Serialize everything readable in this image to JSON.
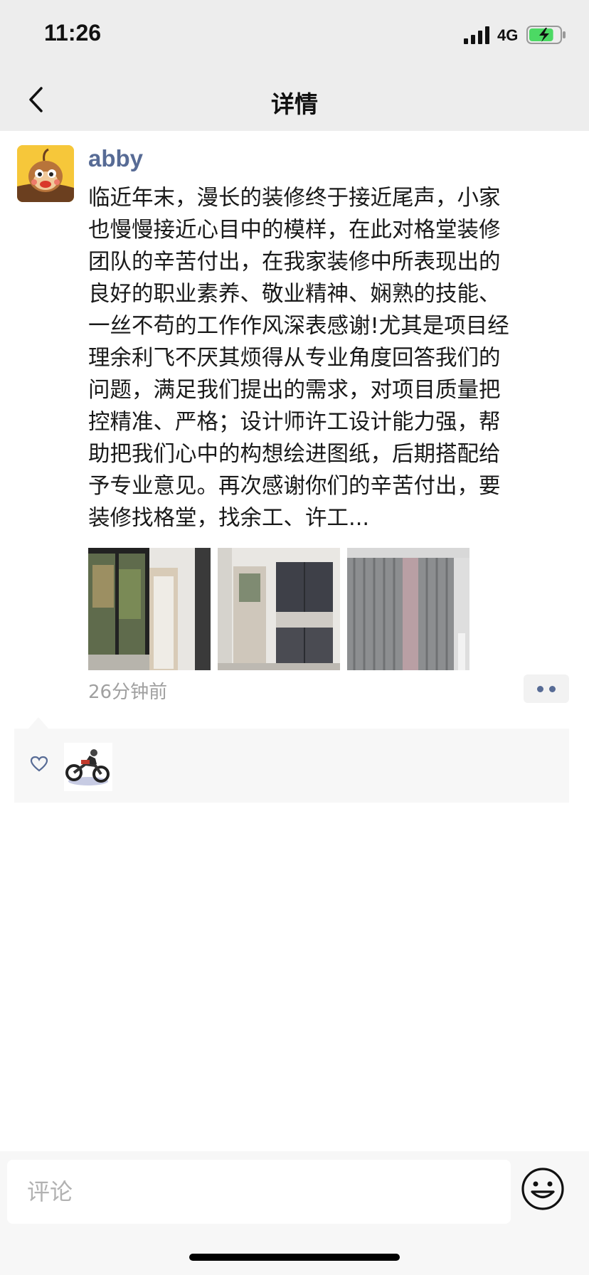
{
  "status_bar": {
    "time": "11:26",
    "network": "4G",
    "battery_fill": 0.8,
    "battery_color": "#4cd964"
  },
  "nav": {
    "title": "详情",
    "back_icon": "chevron-left-icon"
  },
  "post": {
    "author": "abby",
    "author_color": "#576b95",
    "content": "临近年末，漫长的装修终于接近尾声，小家\n也慢慢接近心目中的模样，在此对格堂装修\n团队的辛苦付出，在我家装修中所表现出的\n良好的职业素养、敬业精神、娴熟的技能、\n一丝不苟的工作作风深表感谢!尤其是项目经\n理余利飞不厌其烦得从专业角度回答我们的\n问题，满足我们提出的需求，对项目质量把\n控精准、严格；设计师许工设计能力强，帮\n助把我们心中的构想绘进图纸，后期搭配给\n予专业意见。再次感谢你们的辛苦付出，要\n装修找格堂，找余工、许工...",
    "photos": [
      "room-window-photo",
      "kitchen-cabinet-photo",
      "curtain-photo"
    ],
    "timestamp": "26分钟前"
  },
  "likes": {
    "icon": "heart-icon",
    "likers": [
      "motorcycle-avatar"
    ]
  },
  "comment_bar": {
    "placeholder": "评论",
    "emoji_icon": "smiley-icon"
  }
}
